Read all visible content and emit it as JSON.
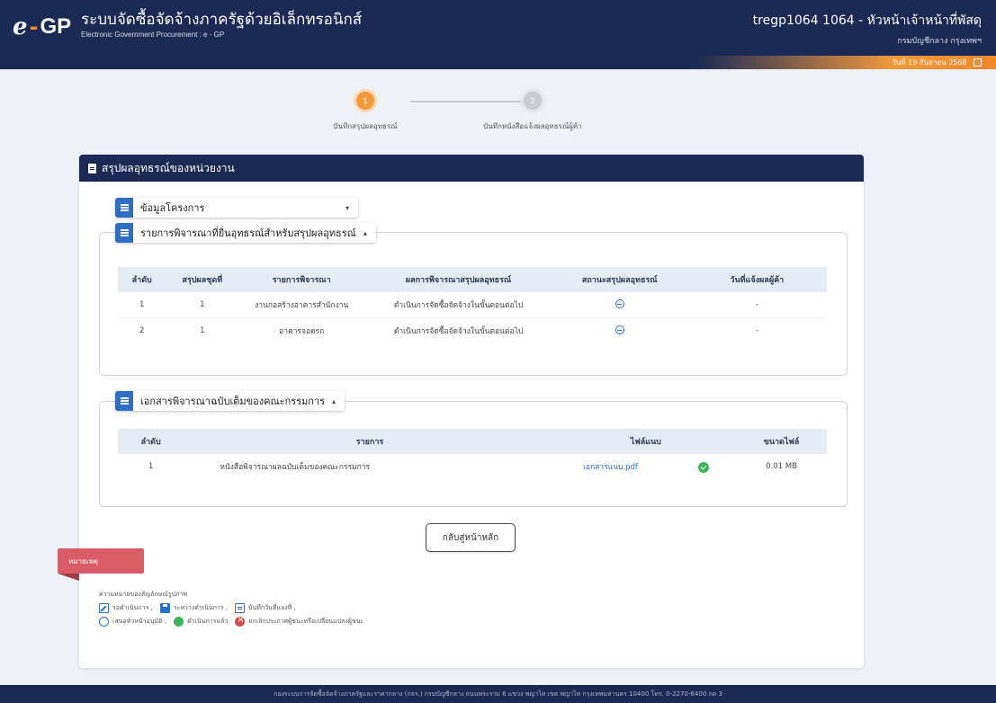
{
  "header": {
    "logo_e": "e",
    "logo_dash": "-",
    "logo_gp": "GP",
    "title_th": "ระบบจัดซื้อจัดจ้างภาครัฐด้วยอิเล็กทรอนิกส์",
    "title_en": "Electronic Government Procurement : e - GP",
    "user_name": "tregp1064 1064 - หัวหน้าเจ้าหน้าที่พัสดุ",
    "user_dept": "กรมบัญชีกลาง กรุงเทพฯ",
    "date": "วันที่ 19 กันยายน 2568"
  },
  "stepper": {
    "steps": [
      {
        "number": "1",
        "label": "บันทึกสรุปผลอุทธรณ์",
        "state": "active"
      },
      {
        "number": "2",
        "label": "บันทึกหนังสือแจ้งผลอุทธรณ์ผู้ค้า",
        "state": "inactive"
      }
    ]
  },
  "card": {
    "title": "สรุปผลอุทธรณ์ของหน่วยงาน"
  },
  "project_info": {
    "label": "ข้อมูลโครงการ",
    "caret": "▾"
  },
  "consideration": {
    "label": "รายการพิจารณาที่ยื่นอุทธรณ์สำหรับสรุปผลอุทธรณ์",
    "caret": "▴",
    "columns": [
      "ลำดับ",
      "สรุปผลชุดที่",
      "รายการพิจารณา",
      "ผลการพิจารณาสรุปผลอุทธรณ์",
      "สถานะสรุปผลอุทธรณ์",
      "วันที่แจ้งผลผู้ค้า"
    ],
    "rows": [
      {
        "no": "1",
        "set": "1",
        "item": "งานก่อสร้างอาคารสำนักงาน",
        "result": "ดำเนินการจัดซื้อจัดจ้างในขั้นตอนต่อไป",
        "status_icon": "user-icon",
        "notify_date": "-"
      },
      {
        "no": "2",
        "set": "1",
        "item": "อาคารจอดรถ",
        "result": "ดำเนินการจัดซื้อจัดจ้างในขั้นตอนต่อไป",
        "status_icon": "user-icon",
        "notify_date": "-"
      }
    ]
  },
  "documents": {
    "label": "เอกสารพิจารณาฉบับเต็มของคณะกรรมการ",
    "caret": "▴",
    "columns": [
      "ลำดับ",
      "รายการ",
      "ไฟล์แนบ",
      "ขนาดไฟล์"
    ],
    "rows": [
      {
        "no": "1",
        "item": "หนังสือพิจารณาผลฉบับเต็มของคณะกรรมการ",
        "file": "เอกสารแนบ.pdf",
        "file_icon": "check-icon",
        "size": "0.01 MB"
      }
    ]
  },
  "back_button": "กลับสู่หน้าหลัก",
  "notes": {
    "tag": "หมายเหตุ",
    "title": "ความหมายของสัญลักษณ์รูปภาพ",
    "legend_row1": [
      {
        "icon": "edit-icon",
        "label": "รอดำเนินการ ,"
      },
      {
        "icon": "save-icon",
        "label": "ระหว่างดำเนินการ ,"
      },
      {
        "icon": "record-icon",
        "label": "บันทึกวันที่แลงที่ ,"
      }
    ],
    "legend_row2": [
      {
        "icon": "user-icon",
        "label": "เสนอหัวหน้าอนุมัติ ,"
      },
      {
        "icon": "check-icon",
        "label": "ดำเนินการแล้ว"
      },
      {
        "icon": "cancel-icon",
        "label": "ยกเลิกประกาศผู้ชนะหรือเปลี่ยนแปลงผู้ชนะ"
      }
    ]
  },
  "footer": {
    "text": "กองระบบการจัดซื้อจัดจ้างภาครัฐและราคากลาง (กจร.) กรมบัญชีกลาง ถนนพระราม 6 แขวง พญาไท เขต พญาไท กรุงเทพมหานคร 10400 โทร. 0-2270-6400 กด 3"
  },
  "colors": {
    "navy": "#1b2a55",
    "orange": "#f39a3b",
    "blue": "#2d6fc4",
    "green": "#3ab45a",
    "red_tag": "#d95c66"
  }
}
